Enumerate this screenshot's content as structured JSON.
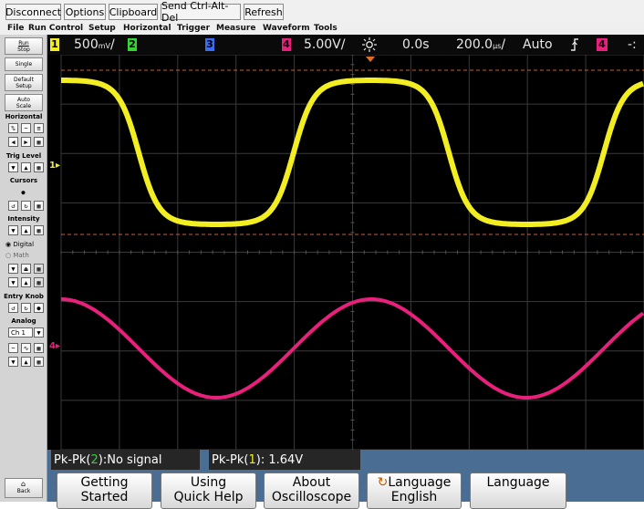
{
  "toolbar": {
    "buttons": [
      "Disconnect",
      "Options",
      "Clipboard",
      "Send Ctrl-Alt-Del",
      "Refresh"
    ]
  },
  "menu": [
    "File",
    "Run Control",
    "Setup",
    "Horizontal",
    "Trigger",
    "Measure",
    "Waveform",
    "Tools"
  ],
  "channel_bar": {
    "ch1_box": "1",
    "ch1_scale": "500",
    "ch1_unit": "mV",
    "ch2_box": "2",
    "ch3_box": "3",
    "ch4_box": "4",
    "ch4_scale": "5.00V/",
    "delay": "0.0s",
    "timebase_value": "200.0",
    "timebase_unit": "µs",
    "trigger_mode": "Auto",
    "trigger_slope_icon": "rising-edge-icon",
    "trigger_source_box": "4",
    "clipped_text": "-:"
  },
  "colors": {
    "ch1": "#f2ee22",
    "ch2": "#35d435",
    "ch3": "#3c6df0",
    "ch4": "#e8207c",
    "grid": "#3a3a3a",
    "trigger_level": "#c8603a",
    "bottom_panel": "#4a6d94"
  },
  "sidebar": {
    "run_stop": [
      "Run",
      "Stop"
    ],
    "single": "Single",
    "default_setup": [
      "Default",
      "Setup"
    ],
    "auto_scale": [
      "Auto",
      "Scale"
    ],
    "horizontal": "Horizontal",
    "trig_level": "Trig Level",
    "cursors": "Cursors",
    "intensity": "Intensity",
    "digital": "Digital",
    "math": "Math",
    "entry_knob": "Entry Knob",
    "analog": "Analog",
    "analog_select": "Ch 1",
    "back": "Back"
  },
  "markers": {
    "ch1": "1",
    "ch4": "4"
  },
  "measurements": [
    {
      "prefix": "Pk-Pk(",
      "channel": "2",
      "suffix": "):No signal"
    },
    {
      "prefix": "Pk-Pk(",
      "channel": "1",
      "suffix": "): 1.64V"
    }
  ],
  "softkeys": [
    {
      "line1": "Getting",
      "line2": "Started"
    },
    {
      "line1": "Using",
      "line2": "Quick Help"
    },
    {
      "line1": "About",
      "line2": "Oscilloscope"
    },
    {
      "line1": "Language",
      "line2": "English"
    },
    {
      "line1": "Language",
      "line2": ""
    }
  ]
}
